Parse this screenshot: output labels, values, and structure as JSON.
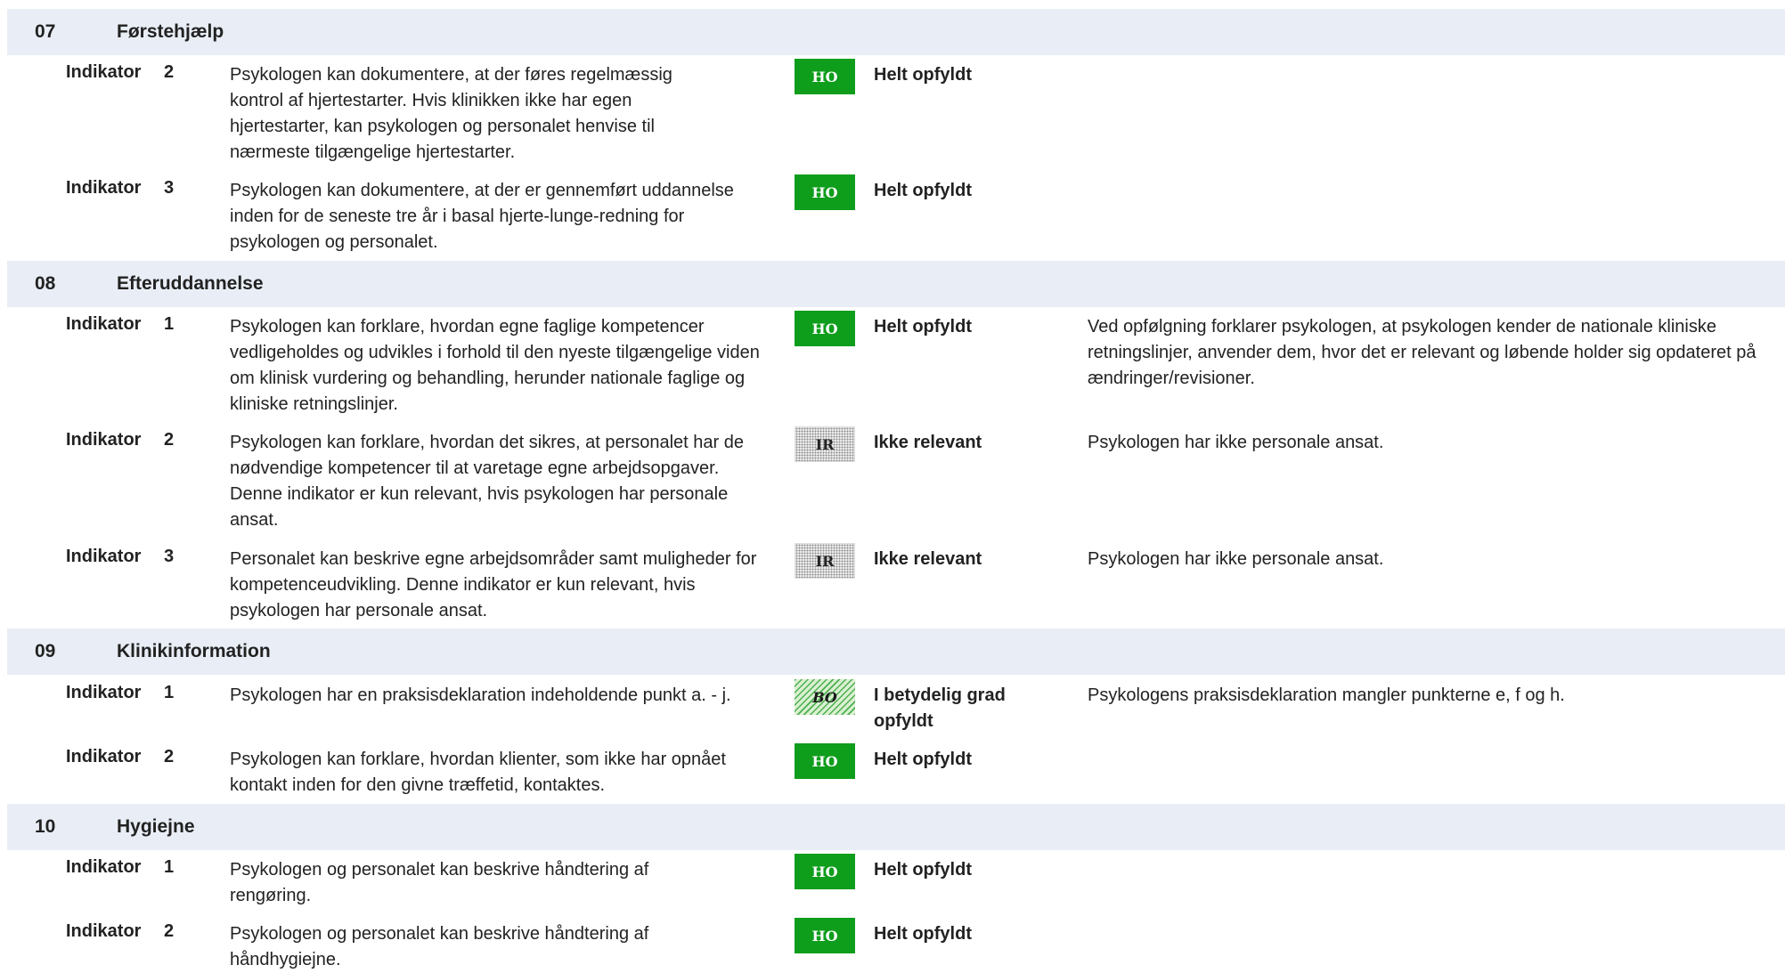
{
  "sections": [
    {
      "number": "07",
      "title": "Førstehjælp",
      "indicators": [
        {
          "label": "Indikator",
          "number": "2",
          "text": "Psykologen kan dokumentere, at der føres regelmæssig kontrol af hjertestarter.   Hvis klinikken ikke har egen hjertestarter, kan psykologen og personalet henvise til nærmeste tilgængelige hjertestarter.",
          "badge": "HO",
          "status": "Helt opfyldt",
          "comment": ""
        },
        {
          "label": "Indikator",
          "number": "3",
          "text": "Psykologen kan dokumentere, at der er gennemført uddannelse inden for de seneste tre år i basal hjerte-lunge-redning for psykologen og personalet.",
          "badge": "HO",
          "status": "Helt opfyldt",
          "comment": ""
        }
      ]
    },
    {
      "number": "08",
      "title": "Efteruddannelse",
      "indicators": [
        {
          "label": "Indikator",
          "number": "1",
          "text": "Psykologen kan forklare, hvordan egne faglige kompetencer vedligeholdes og udvikles i forhold til den nyeste tilgængelige viden om klinisk vurdering og behandling, herunder nationale faglige og kliniske retningslinjer.",
          "badge": "HO",
          "status": "Helt opfyldt",
          "comment": " Ved opfølgning forklarer psykologen, at psykologen kender de nationale kliniske retningslinjer, anvender dem, hvor det er relevant og løbende holder sig opdateret på ændringer/revisioner."
        },
        {
          "label": "Indikator",
          "number": "2",
          "text": "Psykologen kan forklare, hvordan det sikres, at personalet har de nødvendige kompetencer til at varetage egne arbejdsopgaver.   Denne indikator er kun relevant, hvis psykologen har personale ansat.",
          "badge": "IR",
          "status": "Ikke relevant",
          "comment": "Psykologen har ikke personale ansat."
        },
        {
          "label": "Indikator",
          "number": "3",
          "text": "Personalet kan beskrive egne arbejdsområder samt muligheder for kompetenceudvikling.   Denne indikator er kun relevant, hvis psykologen har personale ansat.",
          "badge": "IR",
          "status": "Ikke relevant",
          "comment": "Psykologen har ikke personale ansat."
        }
      ]
    },
    {
      "number": "09",
      "title": "Klinikinformation",
      "indicators": [
        {
          "label": "Indikator",
          "number": "1",
          "text": "Psykologen har en praksisdeklaration indeholdende punkt a. - j.",
          "badge": "BO",
          "status": "I betydelig grad opfyldt",
          "comment": "Psykologens praksisdeklaration mangler punkterne e,  f og h."
        },
        {
          "label": "Indikator",
          "number": "2",
          "text": "Psykologen kan forklare, hvordan klienter, som ikke har opnået kontakt inden for den givne træffetid, kontaktes.",
          "badge": "HO",
          "status": "Helt opfyldt",
          "comment": ""
        }
      ]
    },
    {
      "number": "10",
      "title": "Hygiejne",
      "indicators": [
        {
          "label": "Indikator",
          "number": "1",
          "text": "Psykologen og personalet kan beskrive håndtering af rengøring.",
          "badge": "HO",
          "status": "Helt opfyldt",
          "comment": ""
        },
        {
          "label": "Indikator",
          "number": "2",
          "text": "Psykologen og personalet kan beskrive håndtering af håndhygiejne.",
          "badge": "HO",
          "status": "Helt opfyldt",
          "comment": ""
        }
      ]
    }
  ]
}
